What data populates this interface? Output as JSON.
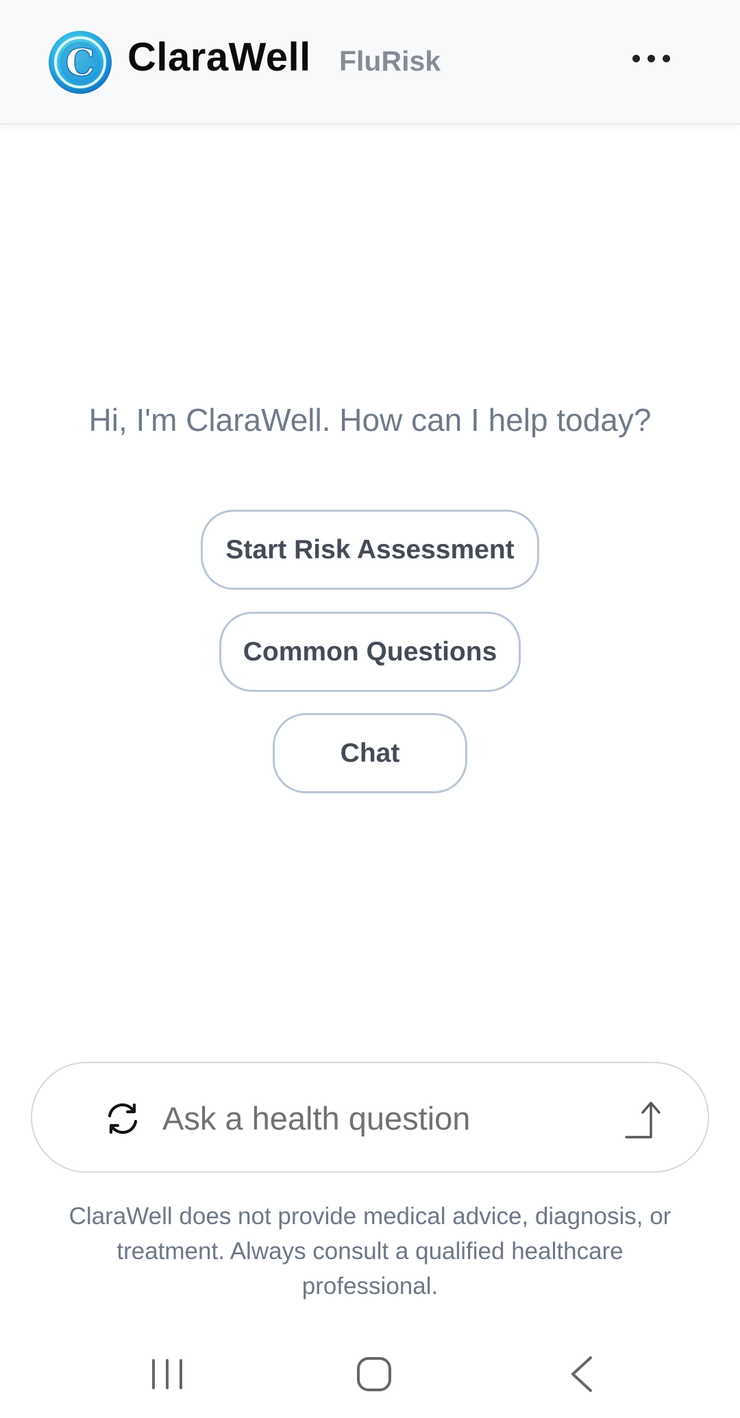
{
  "header": {
    "brand": "ClaraWell",
    "product": "FluRisk",
    "logo_letter": "C",
    "menu_icon": "more-horizontal-icon"
  },
  "main": {
    "greeting": "Hi, I'm ClaraWell. How can I help today?",
    "actions": [
      {
        "label": "Start Risk Assessment"
      },
      {
        "label": "Common Questions"
      },
      {
        "label": "Chat"
      }
    ]
  },
  "composer": {
    "placeholder": "Ask a health question",
    "value": "",
    "refresh_icon": "refresh-icon",
    "send_icon": "send-arrow-icon"
  },
  "disclaimer": "ClaraWell does not provide medical advice, diagnosis, or treatment. Always consult a qualified healthcare professional.",
  "system_nav": {
    "icons": [
      "recents-icon",
      "home-icon",
      "back-icon"
    ]
  },
  "colors": {
    "header_bg": "#f8f9fb",
    "button_border": "#b9c6d6",
    "button_text": "#454c57",
    "greeting_text": "#6f7a89",
    "logo_blue": "#1c8fd6",
    "logo_cyan": "#3fd0ec"
  }
}
